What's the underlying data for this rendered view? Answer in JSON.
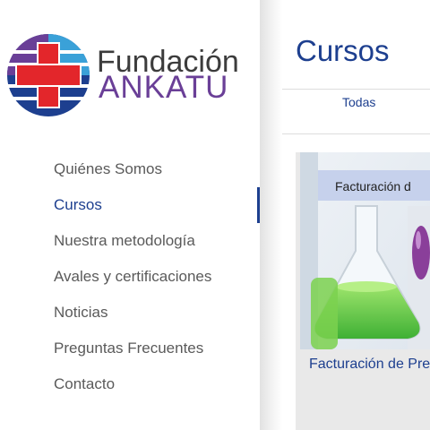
{
  "brand": {
    "name_line1": "Fundación",
    "name_line2": "ANKATU"
  },
  "nav": {
    "items": [
      {
        "label": "Quiénes Somos"
      },
      {
        "label": "Cursos"
      },
      {
        "label": "Nuestra metodología"
      },
      {
        "label": "Avales y certificaciones"
      },
      {
        "label": "Noticias"
      },
      {
        "label": "Preguntas Frecuentes"
      },
      {
        "label": "Contacto"
      }
    ],
    "active_index": 1
  },
  "main": {
    "title": "Cursos",
    "filters": [
      {
        "label": "Todas"
      }
    ],
    "courses": [
      {
        "image_caption": "Facturación d",
        "title": "Facturación de Pre"
      }
    ]
  },
  "colors": {
    "brand_blue": "#1d3f8f",
    "brand_purple": "#6a3f97",
    "cross_red": "#e3262b"
  }
}
